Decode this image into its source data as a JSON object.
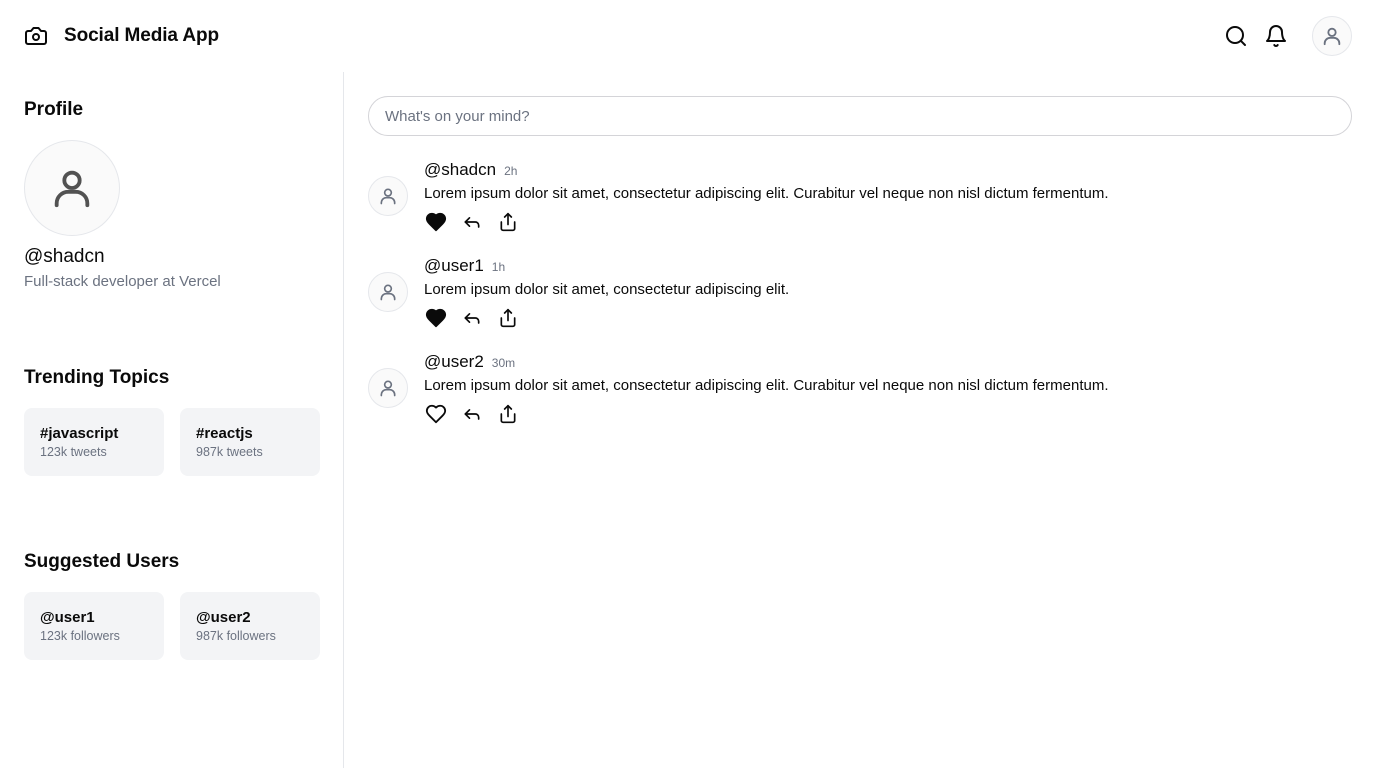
{
  "header": {
    "brand_icon": "camera-icon",
    "title": "Social Media App",
    "actions": [
      "search-icon",
      "bell-icon",
      "user-avatar-icon"
    ]
  },
  "sidebar": {
    "profile": {
      "title": "Profile",
      "avatar_icon": "user-icon",
      "handle": "@shadcn",
      "bio": "Full-stack developer at Vercel"
    },
    "trending": {
      "title": "Trending Topics",
      "items": [
        {
          "tag": "#javascript",
          "count": "123k tweets"
        },
        {
          "tag": "#reactjs",
          "count": "987k tweets"
        }
      ]
    },
    "suggested": {
      "title": "Suggested Users",
      "items": [
        {
          "handle": "@user1",
          "followers": "123k followers"
        },
        {
          "handle": "@user2",
          "followers": "987k followers"
        }
      ]
    }
  },
  "main": {
    "composer": {
      "placeholder": "What's on your mind?"
    },
    "posts": [
      {
        "handle": "@shadcn",
        "time": "2h",
        "text": "Lorem ipsum dolor sit amet, consectetur adipiscing elit. Curabitur vel neque non nisl dictum fermentum.",
        "liked": true
      },
      {
        "handle": "@user1",
        "time": "1h",
        "text": "Lorem ipsum dolor sit amet, consectetur adipiscing elit.",
        "liked": true
      },
      {
        "handle": "@user2",
        "time": "30m",
        "text": "Lorem ipsum dolor sit amet, consectetur adipiscing elit. Curabitur vel neque non nisl dictum fermentum.",
        "liked": false
      }
    ]
  },
  "colors": {
    "text": "#0a0a0a",
    "muted": "#6b7280",
    "card_bg": "#f3f4f6",
    "border": "#e5e7eb"
  }
}
